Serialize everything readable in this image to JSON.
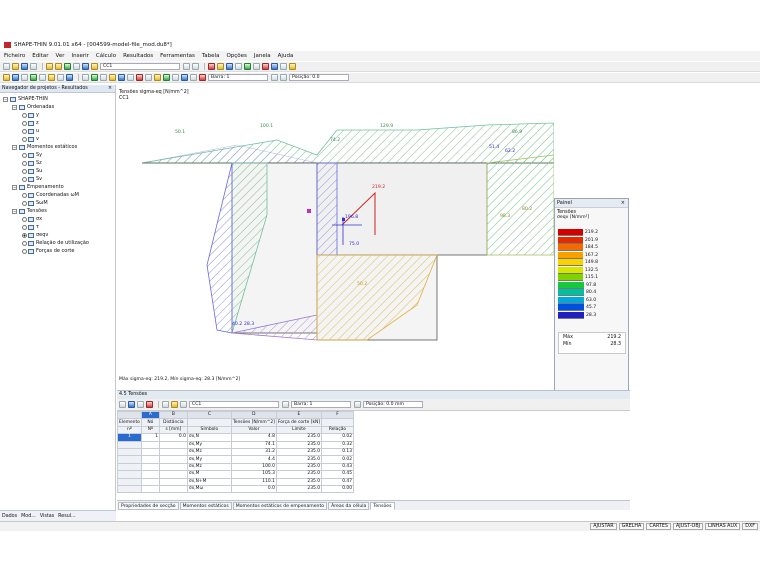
{
  "app": {
    "title": "SHAPE-THIN 9.01.01 x64 - [004599-model-file_mod.du8*]"
  },
  "menu": [
    "Ficheiro",
    "Editar",
    "Ver",
    "Inserir",
    "Cálculo",
    "Resultados",
    "Ferramentas",
    "Tabela",
    "Opções",
    "Janela",
    "Ajuda"
  ],
  "toolbar": {
    "loadcase": "CC1",
    "bar_label": "Barra: 1",
    "position_label": "Posição: 0.0"
  },
  "navigator": {
    "title": "Navegador de projetos - Resultados",
    "tree": [
      {
        "label": "SHAPE-THIN",
        "kind": "root"
      },
      {
        "label": "Ordenadas",
        "kind": "folder"
      },
      {
        "label": "y",
        "kind": "item"
      },
      {
        "label": "z",
        "kind": "item"
      },
      {
        "label": "u",
        "kind": "item"
      },
      {
        "label": "v",
        "kind": "item"
      },
      {
        "label": "Momentos estáticos",
        "kind": "folder"
      },
      {
        "label": "Sy",
        "kind": "item"
      },
      {
        "label": "Sz",
        "kind": "item"
      },
      {
        "label": "Su",
        "kind": "item"
      },
      {
        "label": "Sv",
        "kind": "item"
      },
      {
        "label": "Empenamento",
        "kind": "folder"
      },
      {
        "label": "Coordenadas ωM",
        "kind": "item"
      },
      {
        "label": "SωM",
        "kind": "item"
      },
      {
        "label": "Tensões",
        "kind": "folder"
      },
      {
        "label": "σx",
        "kind": "item"
      },
      {
        "label": "τ",
        "kind": "item"
      },
      {
        "label": "σeqv",
        "kind": "item-selected"
      },
      {
        "label": "Relação de utilização",
        "kind": "item"
      },
      {
        "label": "Forças de corte",
        "kind": "item"
      }
    ],
    "tabs": [
      "Dados",
      "Mod...",
      "Vistas",
      "Resul..."
    ]
  },
  "graphic": {
    "title_line1": "Tensões sigma-eq [N/mm^2]",
    "title_line2": "CC1",
    "footer": "Máx sigma-eq: 219.2, Mín sigma-eq: 28.3 [N/mm^2]",
    "labels": [
      "50.1",
      "100.1",
      "74.2",
      "129.9",
      "86.9",
      "51.4",
      "62.2",
      "219.2",
      "196.8",
      "98.3",
      "80.2",
      "50.2",
      "40.2",
      "28.3",
      "75.0"
    ]
  },
  "panel": {
    "title": "Painel",
    "subtitle": "Tensões",
    "unit": "σeqv [N/mm²]",
    "legend": [
      {
        "value": "219.2",
        "color": "#d40000"
      },
      {
        "value": "201.9",
        "color": "#e62a00"
      },
      {
        "value": "184.5",
        "color": "#f26a00"
      },
      {
        "value": "167.2",
        "color": "#f7a000"
      },
      {
        "value": "149.8",
        "color": "#f9d200"
      },
      {
        "value": "132.5",
        "color": "#d8e600"
      },
      {
        "value": "115.1",
        "color": "#7fd400"
      },
      {
        "value": "97.8",
        "color": "#18c83c"
      },
      {
        "value": "80.4",
        "color": "#00c0a0"
      },
      {
        "value": "63.0",
        "color": "#00a8e0"
      },
      {
        "value": "45.7",
        "color": "#0050e0"
      },
      {
        "value": "28.3",
        "color": "#2020c0"
      }
    ],
    "max_label": "Máx",
    "max_value": "219.2",
    "min_label": "Mín",
    "min_value": "28.3"
  },
  "table": {
    "title": "4.5 Tensões",
    "loadcase": "CC1",
    "bar_label": "Barra: 1",
    "position_label": "Posição: 0.0 mm",
    "col_letters": [
      "A",
      "B",
      "C",
      "D",
      "E",
      "F"
    ],
    "head1": [
      "Elemento",
      "Nó",
      "Distância",
      "",
      "Tensões [N/mm^2]",
      "Força de corte [kN]",
      ""
    ],
    "head2": [
      "nº",
      "Nº",
      "s [mm]",
      "Símbolo",
      "Valor",
      "Limite",
      "Relação"
    ],
    "rows": [
      {
        "el": "1",
        "no": "1",
        "s": "0.0",
        "sym": "σx,N",
        "val": "4.8",
        "lim": "235.0",
        "rel": "0.02"
      },
      {
        "el": "",
        "no": "",
        "s": "",
        "sym": "σx,My",
        "val": "74.1",
        "lim": "235.0",
        "rel": "0.32"
      },
      {
        "el": "",
        "no": "",
        "s": "",
        "sym": "σx,Mz",
        "val": "31.2",
        "lim": "235.0",
        "rel": "0.13"
      },
      {
        "el": "",
        "no": "",
        "s": "",
        "sym": "σx,My",
        "val": "4.4",
        "lim": "235.0",
        "rel": "0.02"
      },
      {
        "el": "",
        "no": "",
        "s": "",
        "sym": "σx,Mz",
        "val": "100.0",
        "lim": "235.0",
        "rel": "0.43"
      },
      {
        "el": "",
        "no": "",
        "s": "",
        "sym": "σx,M",
        "val": "105.3",
        "lim": "235.0",
        "rel": "0.45"
      },
      {
        "el": "",
        "no": "",
        "s": "",
        "sym": "σx,N+M",
        "val": "110.1",
        "lim": "235.0",
        "rel": "0.47"
      },
      {
        "el": "",
        "no": "",
        "s": "",
        "sym": "σx,Mω",
        "val": "0.0",
        "lim": "235.0",
        "rel": "0.00"
      }
    ]
  },
  "sheet_tabs": [
    "Propriedades de secção",
    "Momentos estáticos",
    "Momentos estáticos de empenamento",
    "Áreas da célula",
    "Tensões"
  ],
  "status": [
    "AJUSTAR",
    "GRELHA",
    "CARTES",
    "AJUST-OBJ",
    "LINHAS AUX",
    "DXF"
  ]
}
